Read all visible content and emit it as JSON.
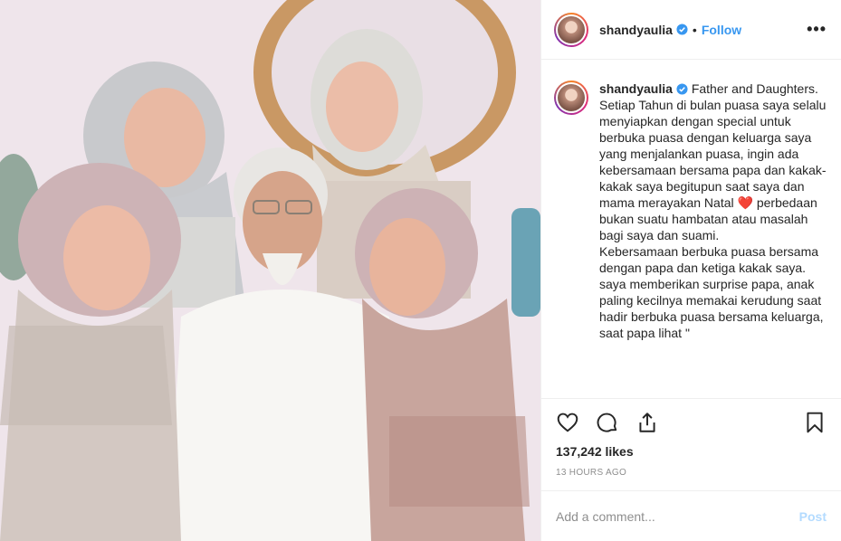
{
  "post": {
    "username": "shandyaulia",
    "follow_label": "Follow",
    "dot": "•",
    "more_label": "•••",
    "photo_alt": "Father and daughters group photo"
  },
  "caption": {
    "username": "shandyaulia",
    "lines": [
      "Father and Daughters.",
      "Setiap Tahun di bulan puasa saya selalu menyiapkan dengan special untuk berbuka puasa dengan keluarga saya yang menjalankan puasa, ingin ada kebersamaan bersama papa dan kakak-kakak saya begitupun saat saya dan mama merayakan Natal",
      "perbedaan bukan suatu hambatan atau masalah bagi saya dan suami.",
      "Kebersamaan berbuka puasa bersama dengan papa dan ketiga kakak saya.",
      "saya memberikan surprise papa, anak paling kecilnya memakai kerudung saat hadir berbuka puasa bersama keluarga, saat papa lihat \""
    ],
    "heart_glyph": "❤️"
  },
  "stats": {
    "likes": "137,242 likes",
    "timestamp": "13 HOURS AGO"
  },
  "comment": {
    "placeholder": "Add a comment...",
    "post_label": "Post"
  },
  "icons": {
    "like": "heart-outline-icon",
    "comment": "comment-bubble-icon",
    "share": "share-upload-icon",
    "save": "bookmark-icon",
    "verified": "verified-badge-icon"
  },
  "colors": {
    "follow_blue": "#3897f0",
    "post_disabled": "#b3dbff",
    "muted_text": "#8e8e8e",
    "border": "#efefef"
  }
}
